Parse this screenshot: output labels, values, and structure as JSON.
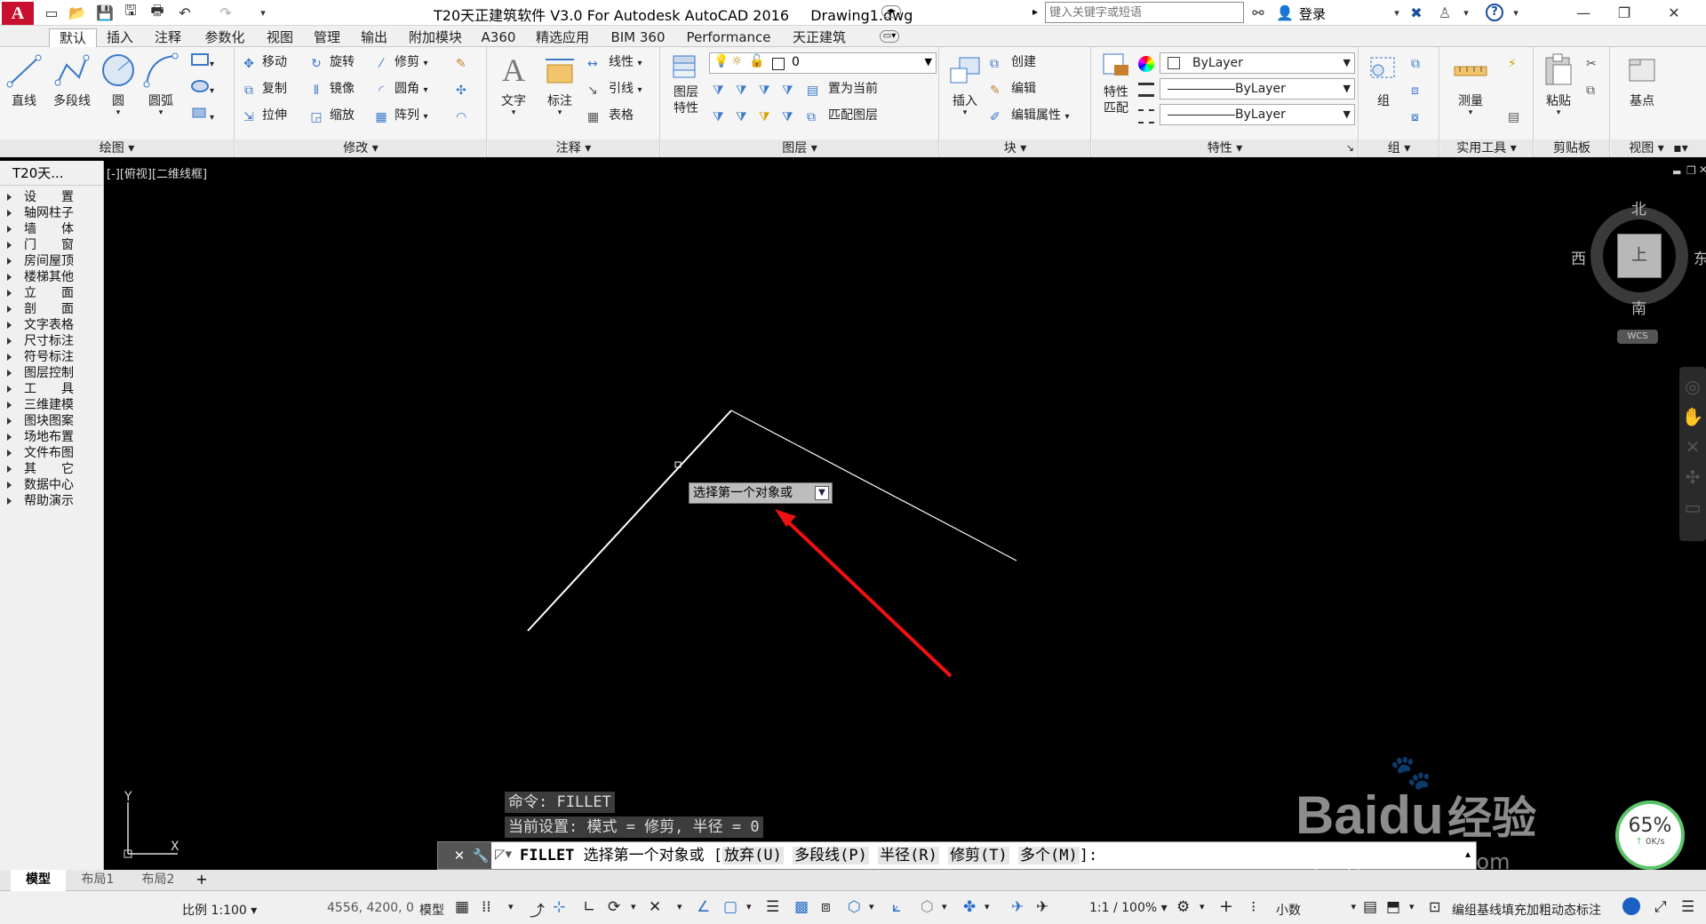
{
  "app": {
    "title": "T20天正建筑软件 V3.0 For Autodesk AutoCAD 2016",
    "document": "Drawing1.dwg",
    "logo_letter": "A"
  },
  "search": {
    "placeholder": "键入关键字或短语"
  },
  "login_label": "登录",
  "tabs": [
    "默认",
    "插入",
    "注释",
    "参数化",
    "视图",
    "管理",
    "输出",
    "附加模块",
    "A360",
    "精选应用",
    "BIM 360",
    "Performance",
    "天正建筑"
  ],
  "ribbon": {
    "draw": {
      "title": "绘图",
      "line": "直线",
      "polyline": "多段线",
      "circle": "圆",
      "arc": "圆弧"
    },
    "modify": {
      "title": "修改",
      "move": "移动",
      "rotate": "旋转",
      "trim": "修剪",
      "copy": "复制",
      "mirror": "镜像",
      "fillet": "圆角",
      "stretch": "拉伸",
      "scale": "缩放",
      "array": "阵列"
    },
    "annotation": {
      "title": "注释",
      "text": "文字",
      "dimension": "标注",
      "linear": "线性",
      "leader": "引线",
      "table": "表格"
    },
    "layers": {
      "title": "图层",
      "properties": "图层\n特性",
      "current_layer": "0",
      "set_current": "置为当前",
      "match_layer": "匹配图层"
    },
    "block": {
      "title": "块",
      "insert": "插入",
      "create": "创建",
      "edit": "编辑",
      "edit_attr": "编辑属性"
    },
    "properties": {
      "title": "特性",
      "match": "特性\n匹配",
      "color": "ByLayer",
      "linetype": "ByLayer",
      "lineweight": "ByLayer"
    },
    "groups": {
      "title": "组",
      "group": "组"
    },
    "utilities": {
      "title": "实用工具",
      "measure": "测量"
    },
    "clipboard": {
      "title": "剪贴板",
      "paste": "粘贴"
    },
    "view": {
      "title": "视图",
      "base": "基点"
    }
  },
  "sidebar": {
    "title": "T20天...",
    "items": [
      "设　　置",
      "轴网柱子",
      "墙　　体",
      "门　　窗",
      "房间屋顶",
      "楼梯其他",
      "立　　面",
      "剖　　面",
      "文字表格",
      "尺寸标注",
      "符号标注",
      "图层控制",
      "工　　具",
      "三维建模",
      "图块图案",
      "场地布置",
      "文件布图",
      "其　　它",
      "数据中心",
      "帮助演示"
    ]
  },
  "viewport": {
    "label": "[-][俯视][二维线框]"
  },
  "viewcube": {
    "north": "北",
    "south": "南",
    "east": "东",
    "west": "西",
    "top": "上",
    "wcs": "WCS"
  },
  "ucs": {
    "x": "X",
    "y": "Y"
  },
  "tooltip": {
    "text": "选择第一个对象或"
  },
  "command": {
    "history1": "命令:  FILLET",
    "history2": "当前设置: 模式 = 修剪, 半径 = 0",
    "prompt_cmd": "FILLET",
    "prompt_text": "选择第一个对象或 [",
    "options": [
      "放弃(U)",
      "多段线(P)",
      "半径(R)",
      "修剪(T)",
      "多个(M)"
    ],
    "prompt_end": "]:"
  },
  "layout_tabs": [
    "模型",
    "布局1",
    "布局2"
  ],
  "status": {
    "scale": "比例 1:100",
    "coords": "4556, 4200, 0",
    "model": "模型",
    "annoscale": "1:1 / 100%",
    "units": "小数",
    "tianzheng": "编组基线填充加粗动态标注"
  },
  "speed": {
    "percent": "65%",
    "rate": "0K/s"
  },
  "watermark": {
    "brand": "Bai",
    "du": "du",
    "jingyan": "经验",
    "url": "jingyan.baidu.com"
  }
}
